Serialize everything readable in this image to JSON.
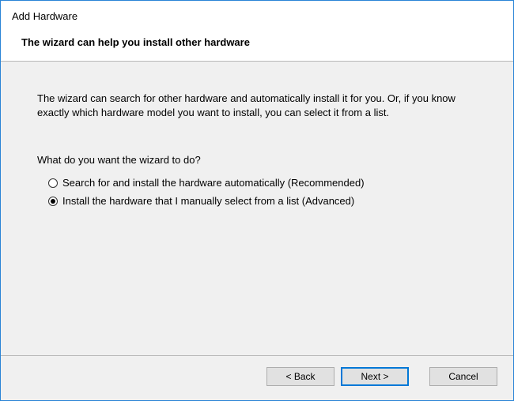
{
  "header": {
    "title": "Add Hardware",
    "subtitle": "The wizard can help you install other hardware"
  },
  "content": {
    "description": "The wizard can search for other hardware and automatically install it for you. Or, if you know exactly which hardware model you want to install, you can select it from a list.",
    "question": "What do you want the wizard to do?",
    "options": [
      {
        "label": "Search for and install the hardware automatically (Recommended)",
        "selected": false
      },
      {
        "label": "Install the hardware that I manually select from a list (Advanced)",
        "selected": true
      }
    ]
  },
  "footer": {
    "back_label": "< Back",
    "next_label": "Next >",
    "cancel_label": "Cancel"
  }
}
